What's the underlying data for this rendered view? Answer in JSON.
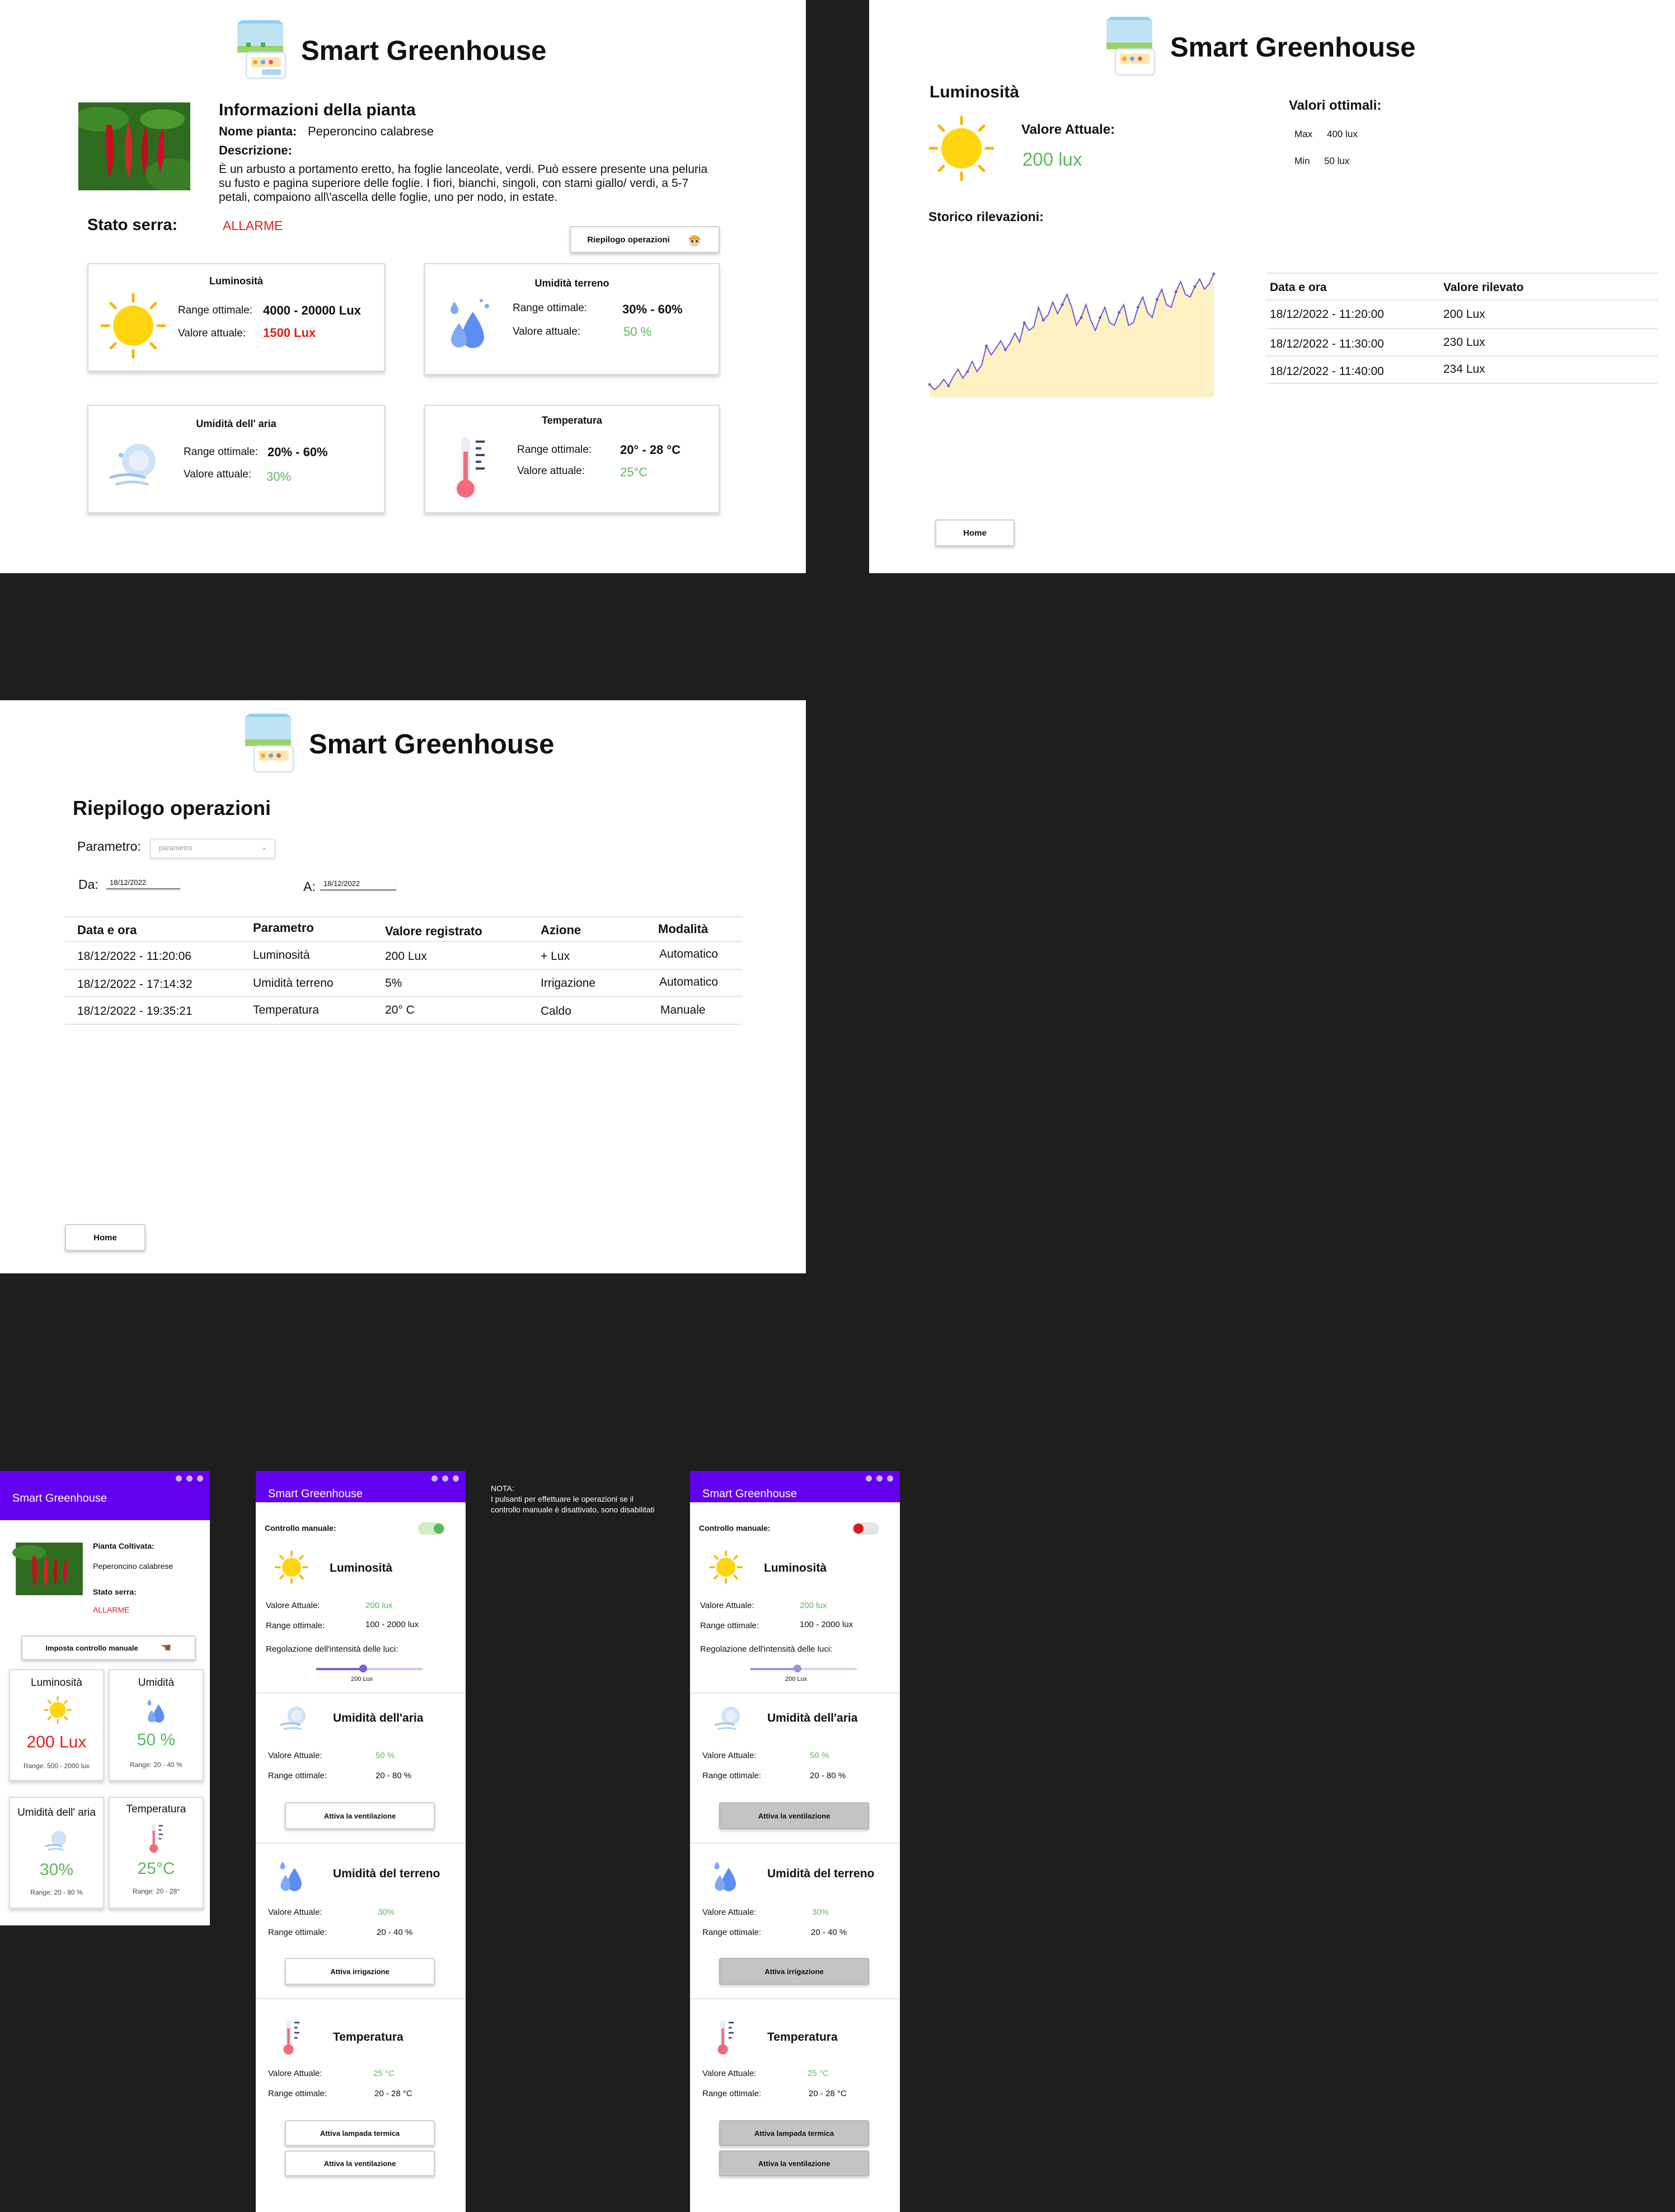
{
  "app_title": "Smart Greenhouse",
  "colors": {
    "accent": "#6200ee",
    "ok": "#5cb85c",
    "alarm": "#e0201d",
    "disabled": "#c4c4c4"
  },
  "dashboard": {
    "plant_info_title": "Informazioni della pianta",
    "plant_name_label": "Nome pianta:",
    "plant_name": "Peperoncino calabrese",
    "description_label": "Descrizione:",
    "description": "È un arbusto a portamento eretto, ha foglie lanceolate, verdi. Può essere presente una peluria su fusto e pagina superiore delle foglie. I fiori, bianchi, singoli, con stami giallo/ verdi, a 5-7 petali, compaiono all\\'ascella delle foglie, uno per nodo, in estate.",
    "status_label": "Stato serra:",
    "status_value": "ALLARME",
    "summary_button": "Riepilogo operazioni",
    "range_label": "Range ottimale:",
    "current_label": "Valore attuale:",
    "cards": [
      {
        "title": "Luminosità",
        "range": "4000 - 20000 Lux",
        "value": "1500 Lux",
        "icon": "sun-icon"
      },
      {
        "title": "Umidità terreno",
        "range": "30% - 60%",
        "value": "50 %",
        "icon": "water-drops-icon"
      },
      {
        "title": "Umidità dell' aria",
        "range": "20% - 60%",
        "value": "30%",
        "icon": "air-humidity-icon"
      },
      {
        "title": "Temperatura",
        "range": "20° - 28 °C",
        "value": "25°C",
        "icon": "thermometer-icon"
      }
    ]
  },
  "detail": {
    "title": "Luminosità",
    "current_label": "Valore Attuale:",
    "current_value": "200 lux",
    "optimal_title": "Valori ottimali:",
    "max_label": "Max",
    "max_value": "400 lux",
    "min_label": "Min",
    "min_value": "50 lux",
    "history_title": "Storico rilevazioni:",
    "table_headers": [
      "Data e ora",
      "Valore rilevato"
    ],
    "table_rows": [
      [
        "18/12/2022 - 11:20:00",
        "200 Lux"
      ],
      [
        "18/12/2022 - 11:30:00",
        "230 Lux"
      ],
      [
        "18/12/2022 - 11:40:00",
        "234 Lux"
      ]
    ],
    "home_button": "Home",
    "chart_data": {
      "type": "area",
      "title": "",
      "xlabel": "",
      "ylabel": "",
      "x_ticks": "none",
      "y_ticks": "none",
      "grid": false,
      "line_color": "#6a5acd",
      "fill_color": "#fdf1c4",
      "ylim": [
        0,
        100
      ],
      "points": [
        [
          0,
          10
        ],
        [
          2,
          6
        ],
        [
          4,
          9
        ],
        [
          6,
          14
        ],
        [
          8,
          9
        ],
        [
          10,
          16
        ],
        [
          12,
          22
        ],
        [
          14,
          15
        ],
        [
          16,
          20
        ],
        [
          18,
          28
        ],
        [
          20,
          20
        ],
        [
          22,
          25
        ],
        [
          24,
          40
        ],
        [
          26,
          33
        ],
        [
          28,
          38
        ],
        [
          30,
          44
        ],
        [
          32,
          37
        ],
        [
          34,
          42
        ],
        [
          36,
          50
        ],
        [
          38,
          43
        ],
        [
          40,
          58
        ],
        [
          42,
          52
        ],
        [
          44,
          55
        ],
        [
          46,
          70
        ],
        [
          48,
          60
        ],
        [
          50,
          64
        ],
        [
          52,
          74
        ],
        [
          54,
          65
        ],
        [
          56,
          72
        ],
        [
          58,
          80
        ],
        [
          60,
          70
        ],
        [
          62,
          56
        ],
        [
          64,
          62
        ],
        [
          66,
          72
        ],
        [
          68,
          60
        ],
        [
          70,
          52
        ],
        [
          72,
          62
        ],
        [
          74,
          70
        ],
        [
          76,
          58
        ],
        [
          78,
          56
        ],
        [
          80,
          66
        ],
        [
          82,
          72
        ],
        [
          84,
          56
        ],
        [
          86,
          58
        ],
        [
          88,
          70
        ],
        [
          90,
          78
        ],
        [
          92,
          66
        ],
        [
          94,
          62
        ],
        [
          96,
          76
        ],
        [
          98,
          84
        ],
        [
          100,
          72
        ],
        [
          102,
          70
        ],
        [
          104,
          82
        ],
        [
          106,
          90
        ],
        [
          108,
          80
        ],
        [
          110,
          78
        ],
        [
          112,
          86
        ],
        [
          114,
          92
        ],
        [
          116,
          84
        ],
        [
          118,
          88
        ],
        [
          120,
          96
        ]
      ]
    }
  },
  "summary": {
    "title": "Riepilogo operazioni",
    "param_label": "Parametro:",
    "param_placeholder": "parametro",
    "from_label": "Da:",
    "from_value": "18/12/2022",
    "to_label": "A:",
    "to_value": "18/12/2022",
    "headers": [
      "Data e ora",
      "Parametro",
      "Valore registrato",
      "Azione",
      "Modalità"
    ],
    "rows": [
      [
        "18/12/2022 - 11:20:06",
        "Luminosità",
        "200 Lux",
        "+ Lux",
        "Automatico"
      ],
      [
        "18/12/2022 - 17:14:32",
        "Umidità terreno",
        "5%",
        "Irrigazione",
        "Automatico"
      ],
      [
        "18/12/2022 - 19:35:21",
        "Temperatura",
        "20° C",
        "Caldo",
        "Manuale"
      ]
    ],
    "home_button": "Home"
  },
  "mobile_home": {
    "plant_label": "Pianta Coltivata:",
    "plant_name": "Peperoncino calabrese",
    "status_label": "Stato serra:",
    "status_value": "ALLARME",
    "manual_button": "Imposta controllo manuale",
    "tiles": [
      {
        "title": "Luminosità",
        "value": "200 Lux",
        "range": "Range: 500 - 2000 lux",
        "icon": "sun-icon"
      },
      {
        "title": "Umidità",
        "value": "50 %",
        "range": "Range: 20 - 40 %",
        "icon": "water-drops-icon"
      },
      {
        "title": "Umidità dell' aria",
        "value": "30%",
        "range": "Range: 20 - 80 %",
        "icon": "air-humidity-icon"
      },
      {
        "title": "Temperatura",
        "value": "25°C",
        "range": "Range: 20 - 28°",
        "icon": "thermometer-icon"
      }
    ]
  },
  "manual": {
    "toggle_label": "Controllo manuale:",
    "current_label": "Valore Attuale:",
    "range_label": "Range ottimale:",
    "lum_title": "Luminosità",
    "lum_value": "200 lux",
    "lum_range": "100 - 2000 lux",
    "slider_label": "Regolazione dell'intensità delle luci:",
    "slider_value": "200 Lux",
    "slider_fraction": 0.44,
    "air_title": "Umidità dell'aria",
    "air_value": "50 %",
    "air_range": "20 - 80 %",
    "air_button": "Attiva la ventilazione",
    "soil_title": "Umidità del terreno",
    "soil_value": "30%",
    "soil_range": "20 - 40 %",
    "soil_button": "Attiva irrigazione",
    "temp_title": "Temperatura",
    "temp_value": "25 °C",
    "temp_range": "20 - 28 °C",
    "temp_button1": "Attiva lampada termica",
    "temp_button2": "Attiva la ventilazione"
  },
  "note": {
    "title": "NOTA:",
    "text": "I pulsanti per effettuare le operazioni se il controllo manuale è disattivato, sono disabilitati"
  }
}
